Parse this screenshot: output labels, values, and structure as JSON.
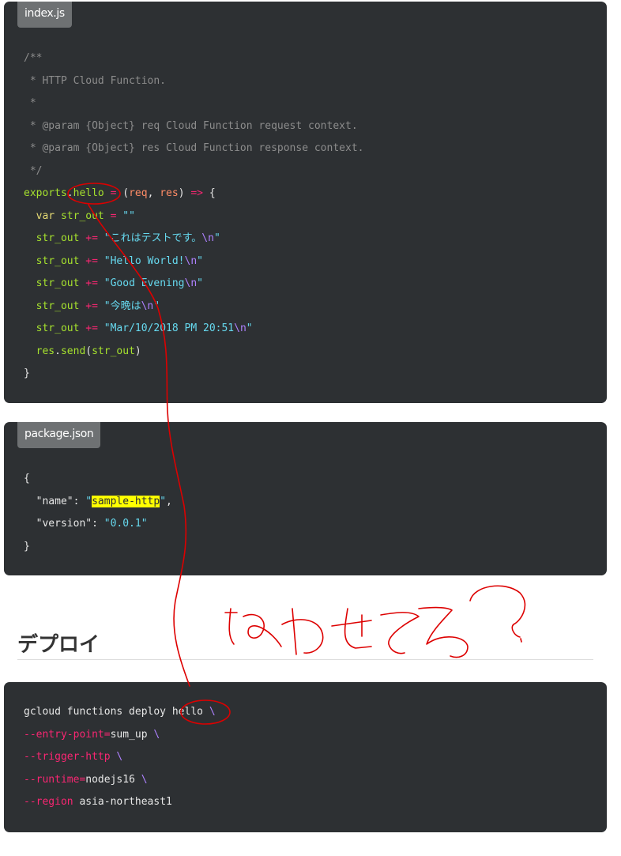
{
  "index_block": {
    "filename": "index.js",
    "lines": [
      [
        {
          "t": "/**",
          "c": "cm"
        }
      ],
      [
        {
          "t": " * HTTP Cloud Function.",
          "c": "cm"
        }
      ],
      [
        {
          "t": " *",
          "c": "cm"
        }
      ],
      [
        {
          "t": " * @param {Object} req Cloud Function request context.",
          "c": "cm"
        }
      ],
      [
        {
          "t": " * @param {Object} res Cloud Function response context.",
          "c": "cm"
        }
      ],
      [
        {
          "t": " */",
          "c": "cm"
        }
      ],
      [
        {
          "t": "exports",
          "c": "gr"
        },
        {
          "t": ".",
          "c": ""
        },
        {
          "t": "hello",
          "c": "gr"
        },
        {
          "t": " = ",
          "c": "pk"
        },
        {
          "t": "(",
          "c": ""
        },
        {
          "t": "req",
          "c": "or"
        },
        {
          "t": ", ",
          "c": ""
        },
        {
          "t": "res",
          "c": "or"
        },
        {
          "t": ") ",
          "c": ""
        },
        {
          "t": "=>",
          "c": "pk"
        },
        {
          "t": " {",
          "c": ""
        }
      ],
      [
        {
          "t": "  ",
          "c": ""
        },
        {
          "t": "var",
          "c": "ye"
        },
        {
          "t": " ",
          "c": ""
        },
        {
          "t": "str_out",
          "c": "gr"
        },
        {
          "t": " = ",
          "c": "pk"
        },
        {
          "t": "\"\"",
          "c": "st"
        }
      ],
      [
        {
          "t": "  str_out ",
          "c": "gr"
        },
        {
          "t": "+=",
          "c": "pk"
        },
        {
          "t": " ",
          "c": ""
        },
        {
          "t": "\"これはテストです。",
          "c": "st"
        },
        {
          "t": "\\n",
          "c": "pu"
        },
        {
          "t": "\"",
          "c": "st"
        }
      ],
      [
        {
          "t": "  str_out ",
          "c": "gr"
        },
        {
          "t": "+=",
          "c": "pk"
        },
        {
          "t": " ",
          "c": ""
        },
        {
          "t": "\"Hello World!",
          "c": "st"
        },
        {
          "t": "\\n",
          "c": "pu"
        },
        {
          "t": "\"",
          "c": "st"
        }
      ],
      [
        {
          "t": "  str_out ",
          "c": "gr"
        },
        {
          "t": "+=",
          "c": "pk"
        },
        {
          "t": " ",
          "c": ""
        },
        {
          "t": "\"Good Evening",
          "c": "st"
        },
        {
          "t": "\\n",
          "c": "pu"
        },
        {
          "t": "\"",
          "c": "st"
        }
      ],
      [
        {
          "t": "  str_out ",
          "c": "gr"
        },
        {
          "t": "+=",
          "c": "pk"
        },
        {
          "t": " ",
          "c": ""
        },
        {
          "t": "\"今晩は",
          "c": "st"
        },
        {
          "t": "\\n",
          "c": "pu"
        },
        {
          "t": "\"",
          "c": "st"
        }
      ],
      [
        {
          "t": "  str_out ",
          "c": "gr"
        },
        {
          "t": "+=",
          "c": "pk"
        },
        {
          "t": " ",
          "c": ""
        },
        {
          "t": "\"Mar/10/2018 PM 20:51",
          "c": "st"
        },
        {
          "t": "\\n",
          "c": "pu"
        },
        {
          "t": "\"",
          "c": "st"
        }
      ],
      [
        {
          "t": "  res",
          "c": "gr"
        },
        {
          "t": ".",
          "c": ""
        },
        {
          "t": "send",
          "c": "gr"
        },
        {
          "t": "(",
          "c": ""
        },
        {
          "t": "str_out",
          "c": "gr"
        },
        {
          "t": ")",
          "c": ""
        }
      ],
      [
        {
          "t": "}",
          "c": ""
        }
      ]
    ]
  },
  "package_block": {
    "filename": "package.json",
    "lines": [
      [
        {
          "t": "{",
          "c": ""
        }
      ],
      [
        {
          "t": "  \"name\": ",
          "c": ""
        },
        {
          "t": "\"",
          "c": "st"
        },
        {
          "t": "sample-http",
          "c": "hl"
        },
        {
          "t": "\"",
          "c": "st"
        },
        {
          "t": ",",
          "c": ""
        }
      ],
      [
        {
          "t": "  \"version\": ",
          "c": ""
        },
        {
          "t": "\"0.0.1\"",
          "c": "st"
        }
      ],
      [
        {
          "t": "}",
          "c": ""
        }
      ]
    ]
  },
  "section_heading": "デプロイ",
  "deploy_block": {
    "lines": [
      [
        {
          "t": "gcloud functions deploy hello ",
          "c": ""
        },
        {
          "t": "\\",
          "c": "pu"
        }
      ],
      [
        {
          "t": "--entry-point",
          "c": "pk"
        },
        {
          "t": "=",
          "c": "pk"
        },
        {
          "t": "sum_up ",
          "c": ""
        },
        {
          "t": "\\",
          "c": "pu"
        }
      ],
      [
        {
          "t": "--trigger-http",
          "c": "pk"
        },
        {
          "t": " ",
          "c": ""
        },
        {
          "t": "\\",
          "c": "pu"
        }
      ],
      [
        {
          "t": "--runtime",
          "c": "pk"
        },
        {
          "t": "=",
          "c": "pk"
        },
        {
          "t": "nodejs16 ",
          "c": ""
        },
        {
          "t": "\\",
          "c": "pu"
        }
      ],
      [
        {
          "t": "--region",
          "c": "pk"
        },
        {
          "t": " asia-northeast1",
          "c": ""
        }
      ]
    ]
  },
  "annotation": {
    "color": "#dd0000",
    "handwritten_text": "あわせてる?"
  }
}
